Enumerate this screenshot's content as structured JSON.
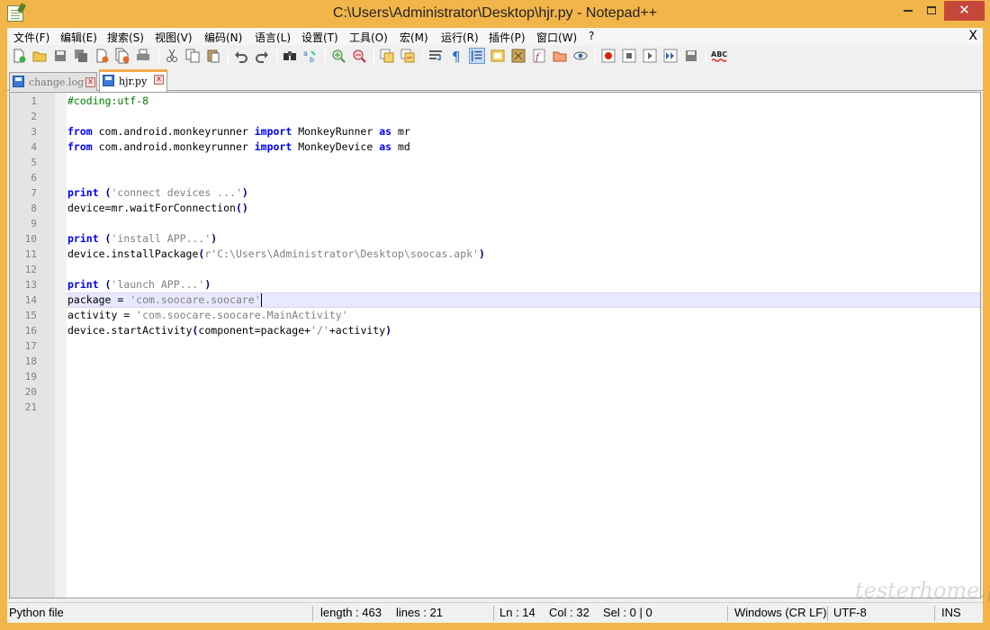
{
  "window": {
    "title": "C:\\Users\\Administrator\\Desktop\\hjr.py - Notepad++",
    "close_glyph": "✕"
  },
  "menu": {
    "items": [
      "文件(F)",
      "编辑(E)",
      "搜索(S)",
      "视图(V)",
      "编码(N)",
      "语言(L)",
      "设置(T)",
      "工具(O)",
      "宏(M)",
      "运行(R)",
      "插件(P)",
      "窗口(W)",
      "?"
    ],
    "close_glyph": "X"
  },
  "toolbar": {
    "icons": [
      "new-file-icon",
      "open-file-icon",
      "save-icon",
      "save-all-icon",
      "close-icon",
      "close-all-icon",
      "print-icon",
      "cut-icon",
      "copy-icon",
      "paste-icon",
      "undo-icon",
      "redo-icon",
      "find-icon",
      "replace-icon",
      "zoom-in-icon",
      "zoom-out-icon",
      "sync-vertical-icon",
      "sync-horizontal-icon",
      "word-wrap-icon",
      "show-all-chars-icon",
      "indent-guide-icon",
      "user-defined-language-icon",
      "document-map-icon",
      "function-list-icon",
      "folder-workspace-icon",
      "monitoring-icon",
      "record-macro-icon",
      "stop-macro-icon",
      "play-macro-icon",
      "run-macro-multiple-icon",
      "save-macro-icon",
      "spell-check-icon"
    ]
  },
  "tabs": [
    {
      "label": "change.log",
      "active": false,
      "close_glyph": "x"
    },
    {
      "label": "hjr.py",
      "active": true,
      "close_glyph": "x"
    }
  ],
  "editor": {
    "current_line": 14,
    "lines": [
      [
        {
          "t": "#coding:utf-8",
          "c": "cm"
        }
      ],
      [],
      [
        {
          "t": "from",
          "c": "kw"
        },
        {
          "t": " com.android.monkeyrunner ",
          "c": "tx"
        },
        {
          "t": "import",
          "c": "kw"
        },
        {
          "t": " MonkeyRunner ",
          "c": "tx"
        },
        {
          "t": "as",
          "c": "kw"
        },
        {
          "t": " mr",
          "c": "tx"
        }
      ],
      [
        {
          "t": "from",
          "c": "kw"
        },
        {
          "t": " com.android.monkeyrunner ",
          "c": "tx"
        },
        {
          "t": "import",
          "c": "kw"
        },
        {
          "t": " MonkeyDevice ",
          "c": "tx"
        },
        {
          "t": "as",
          "c": "kw"
        },
        {
          "t": " md",
          "c": "tx"
        }
      ],
      [],
      [],
      [
        {
          "t": "print",
          "c": "kw"
        },
        {
          "t": " (",
          "c": "op"
        },
        {
          "t": "'connect devices ...'",
          "c": "st"
        },
        {
          "t": ")",
          "c": "op"
        }
      ],
      [
        {
          "t": "device=mr.waitForConnection",
          "c": "tx"
        },
        {
          "t": "()",
          "c": "op"
        }
      ],
      [],
      [
        {
          "t": "print",
          "c": "kw"
        },
        {
          "t": " (",
          "c": "op"
        },
        {
          "t": "'install APP...'",
          "c": "st"
        },
        {
          "t": ")",
          "c": "op"
        }
      ],
      [
        {
          "t": "device.installPackage",
          "c": "tx"
        },
        {
          "t": "(",
          "c": "op"
        },
        {
          "t": "r'C:\\Users\\Administrator\\Desktop\\soocas.apk'",
          "c": "st"
        },
        {
          "t": ")",
          "c": "op"
        }
      ],
      [],
      [
        {
          "t": "print",
          "c": "kw"
        },
        {
          "t": " (",
          "c": "op"
        },
        {
          "t": "'launch APP...'",
          "c": "st"
        },
        {
          "t": ")",
          "c": "op"
        }
      ],
      [
        {
          "t": "package = ",
          "c": "tx"
        },
        {
          "t": "'com.soocare.soocare'",
          "c": "st"
        }
      ],
      [
        {
          "t": "activity = ",
          "c": "tx"
        },
        {
          "t": "'com.soocare.soocare.MainActivity'",
          "c": "st"
        }
      ],
      [
        {
          "t": "device.startActivity",
          "c": "tx"
        },
        {
          "t": "(",
          "c": "op"
        },
        {
          "t": "component=package+",
          "c": "tx"
        },
        {
          "t": "'/'",
          "c": "st"
        },
        {
          "t": "+activity",
          "c": "tx"
        },
        {
          "t": ")",
          "c": "op"
        }
      ],
      [],
      [],
      [],
      [],
      []
    ]
  },
  "status": {
    "file_type": "Python file",
    "length": "length : 463",
    "lines": "lines : 21",
    "ln": "Ln : 14",
    "col": "Col : 32",
    "sel": "Sel : 0 | 0",
    "eol": "Windows (CR LF)",
    "encoding": "UTF-8",
    "mode": "INS"
  },
  "watermark": "testerhome.py"
}
